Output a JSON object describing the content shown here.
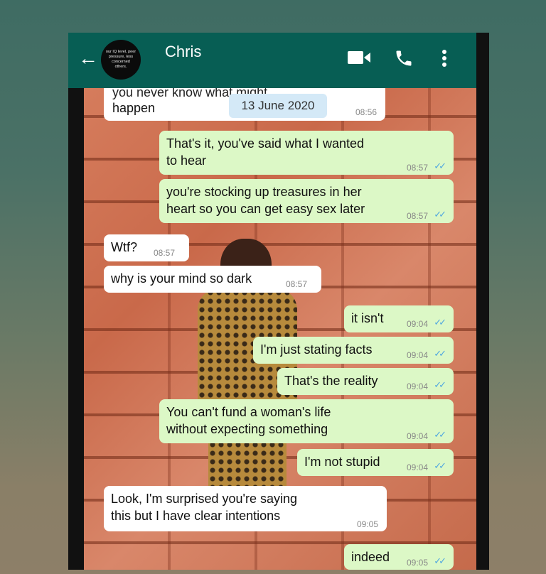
{
  "header": {
    "back_icon": "arrow-left-icon",
    "avatar_text": "our IQ level, peer pressure, less concerned others.",
    "contact_name": "Chris",
    "video_icon": "video-camera-icon",
    "call_icon": "phone-icon",
    "menu_icon": "more-vert-icon",
    "color": "#075e54"
  },
  "date_chip": "13 June 2020",
  "messages": [
    {
      "dir": "in",
      "text": "you never know what might happen",
      "partial_top": "you never know what might",
      "line2": "happen",
      "time": "08:56"
    },
    {
      "dir": "out",
      "line1": "That's it, you've said what I wanted",
      "line2": "to hear",
      "time": "08:57",
      "ticks": "✓✓"
    },
    {
      "dir": "out",
      "line1": "you're stocking up treasures in her",
      "line2": "heart so you can get easy sex later",
      "time": "08:57",
      "ticks": "✓✓"
    },
    {
      "dir": "in",
      "text": "Wtf?",
      "time": "08:57"
    },
    {
      "dir": "in",
      "text": "why is your mind so dark",
      "time": "08:57"
    },
    {
      "dir": "out",
      "text": "it isn't",
      "time": "09:04",
      "ticks": "✓✓"
    },
    {
      "dir": "out",
      "text": "I'm just stating facts",
      "time": "09:04",
      "ticks": "✓✓"
    },
    {
      "dir": "out",
      "text": "That's the reality",
      "time": "09:04",
      "ticks": "✓✓"
    },
    {
      "dir": "out",
      "line1": "You can't fund a woman's life",
      "line2": "without expecting something",
      "time": "09:04",
      "ticks": "✓✓"
    },
    {
      "dir": "out",
      "text": "I'm not stupid",
      "time": "09:04",
      "ticks": "✓✓"
    },
    {
      "dir": "in",
      "line1": "Look, I'm surprised you're saying",
      "line2": "this but I have clear intentions",
      "time": "09:05"
    },
    {
      "dir": "out",
      "text": "indeed",
      "time": "09:05",
      "ticks": "✓✓"
    }
  ],
  "colors": {
    "incoming": "#ffffff",
    "outgoing": "#dcf8c6",
    "read_ticks": "#4fa7e0"
  }
}
